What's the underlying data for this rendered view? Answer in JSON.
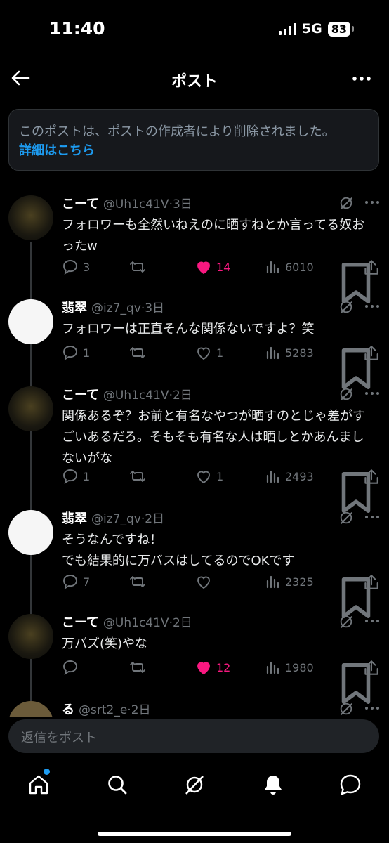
{
  "status": {
    "time": "11:40",
    "network": "5G",
    "battery": "83"
  },
  "header": {
    "title": "ポスト"
  },
  "notice": {
    "text": "このポストは、ポストの作成者により削除されました。",
    "link": "詳細はこちら"
  },
  "tweets": [
    {
      "name": "こーて",
      "handle": "@Uh1c41V",
      "time": "3日",
      "body": "フォロワーも全然いねえのに晒すねとか言ってる奴おったw",
      "replies": "3",
      "retweets": "",
      "likes": "14",
      "views": "6010",
      "liked": true
    },
    {
      "name": "翡翠",
      "handle": "@iz7_qv",
      "time": "3日",
      "body": "フォロワーは正直そんな関係ないですよ？笑",
      "replies": "1",
      "retweets": "",
      "likes": "1",
      "views": "5283",
      "liked": false
    },
    {
      "name": "こーて",
      "handle": "@Uh1c41V",
      "time": "2日",
      "body": "関係あるぞ？お前と有名なやつが晒すのとじゃ差がすごいあるだろ。そもそも有名な人は晒しとかあんましないがな",
      "replies": "1",
      "retweets": "",
      "likes": "1",
      "views": "2493",
      "liked": false
    },
    {
      "name": "翡翠",
      "handle": "@iz7_qv",
      "time": "2日",
      "body": "そうなんですね！\nでも結果的に万バスはしてるのでOKです",
      "replies": "7",
      "retweets": "",
      "likes": "",
      "views": "2325",
      "liked": false
    },
    {
      "name": "こーて",
      "handle": "@Uh1c41V",
      "time": "2日",
      "body": "万バズ(笑)やな",
      "replies": "",
      "retweets": "",
      "likes": "12",
      "views": "1980",
      "liked": true
    },
    {
      "name": "る",
      "handle": "@srt2_e",
      "time": "2日"
    }
  ],
  "reply": {
    "placeholder": "返信をポスト"
  },
  "colors": {
    "accent": "#1d9bf0",
    "like": "#f91880",
    "muted": "#71767b"
  },
  "icons": [
    "back-arrow-icon",
    "more-icon",
    "grok-icon",
    "reply-icon",
    "retweet-icon",
    "like-icon",
    "views-icon",
    "bookmark-icon",
    "share-icon",
    "home-icon",
    "search-icon",
    "grok-nav-icon",
    "notifications-icon",
    "messages-icon"
  ]
}
